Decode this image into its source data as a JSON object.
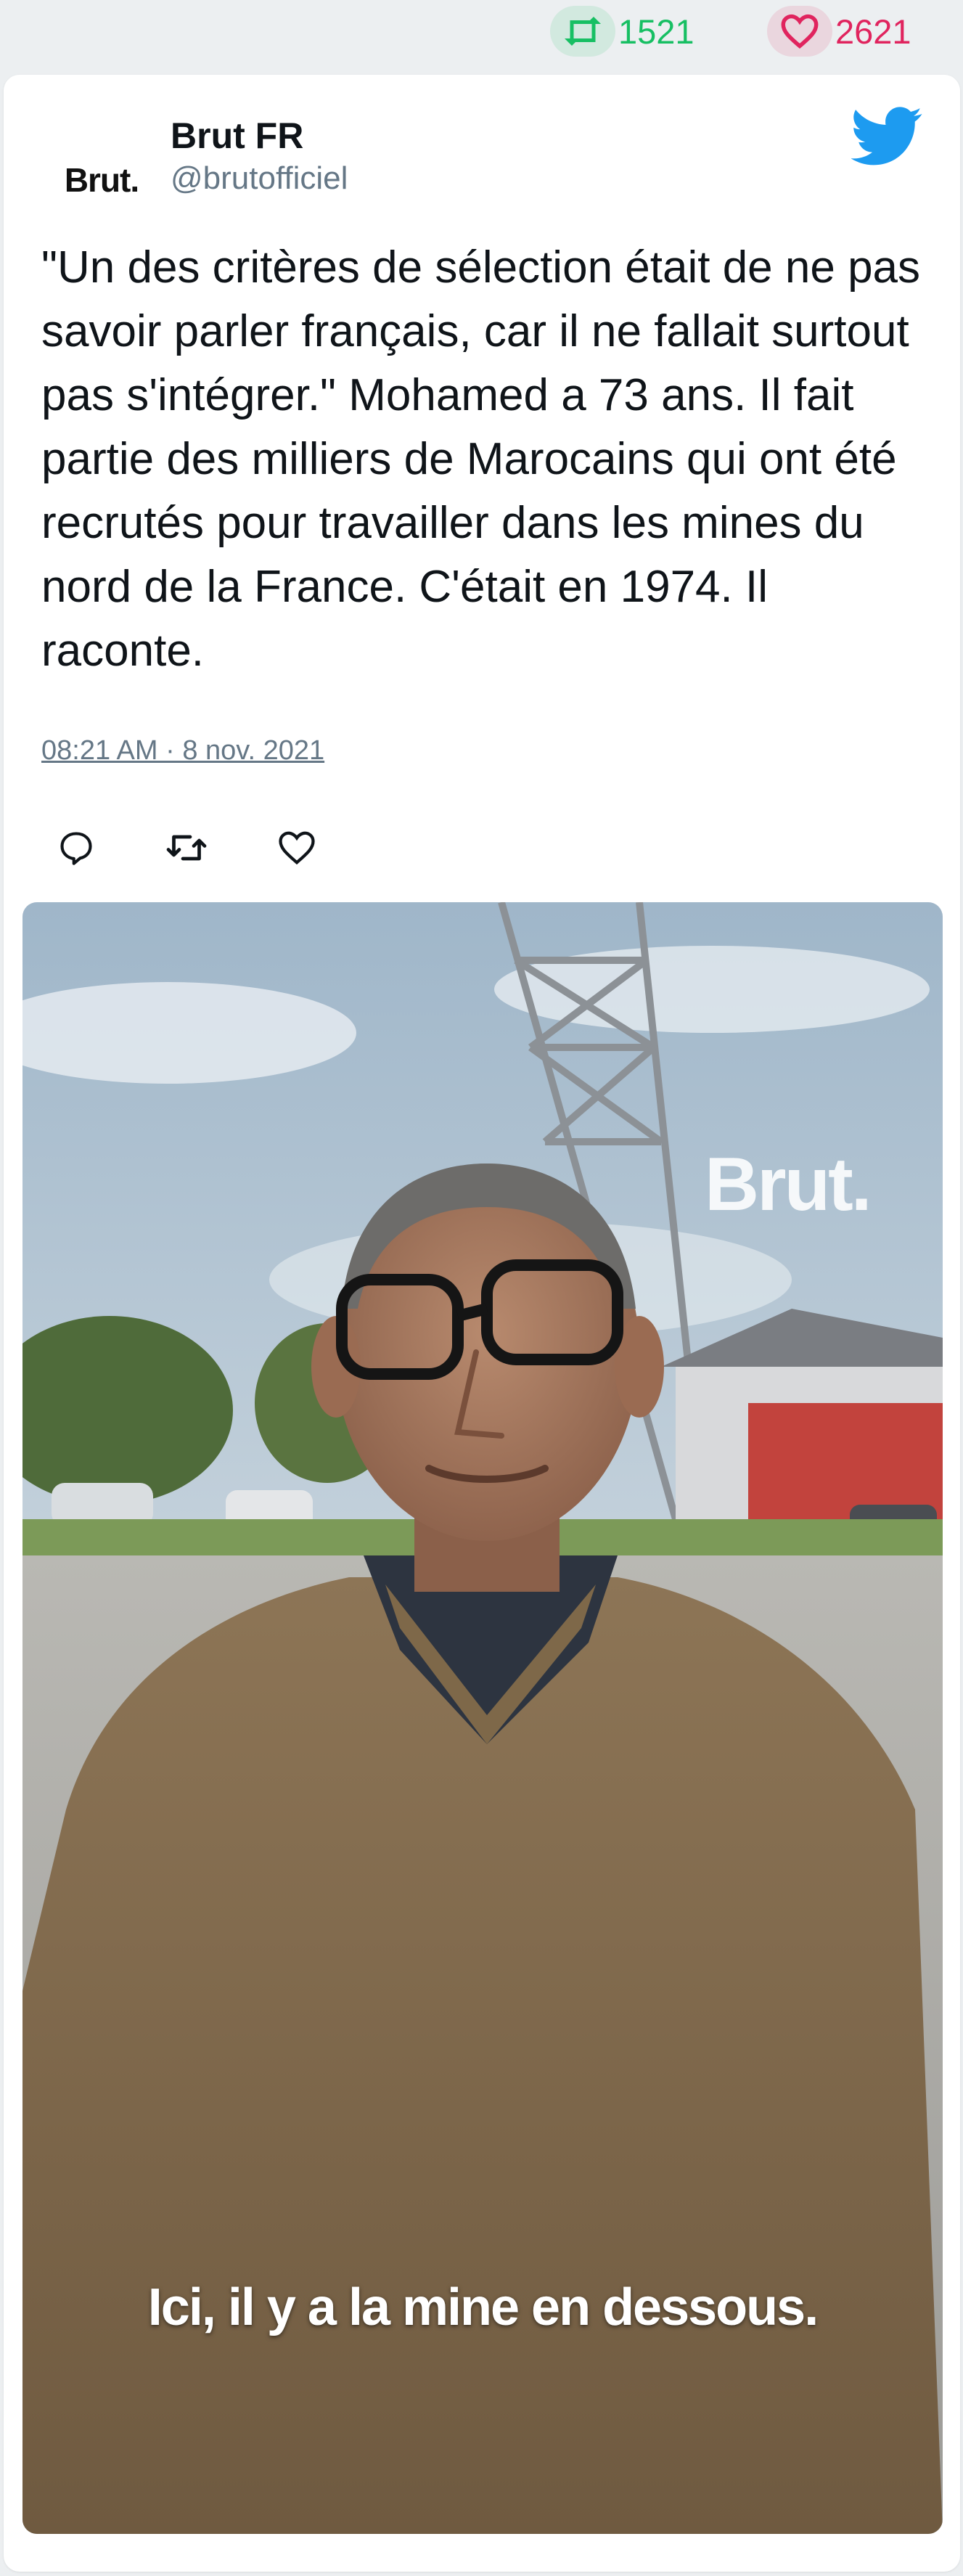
{
  "stats": {
    "retweets": "1521",
    "likes": "2621",
    "retweet_icon": "retweet-icon",
    "like_icon": "heart-icon",
    "retweet_color": "#17bf63",
    "like_color": "#e0245e"
  },
  "tweet": {
    "avatar_text": "Brut.",
    "author_name": "Brut FR",
    "author_handle": "@brutofficiel",
    "platform_icon": "twitter-bird-icon",
    "platform_color": "#1d9bf0",
    "text": "\"Un des critères de sélection était de ne pas savoir parler français, car il ne fallait surtout pas s'intégrer.\" Mohamed a 73 ans. Il fait partie des milliers de Marocains qui ont été recrutés pour travailler dans les mines du nord de la France. C'était en 1974. Il raconte.",
    "timestamp": "08:21 AM · 8 nov. 2021",
    "actions": [
      {
        "name": "reply-icon"
      },
      {
        "name": "retweet-icon"
      },
      {
        "name": "like-icon"
      }
    ]
  },
  "media": {
    "watermark": "Brut.",
    "caption": "Ici, il y a la mine en dessous."
  }
}
